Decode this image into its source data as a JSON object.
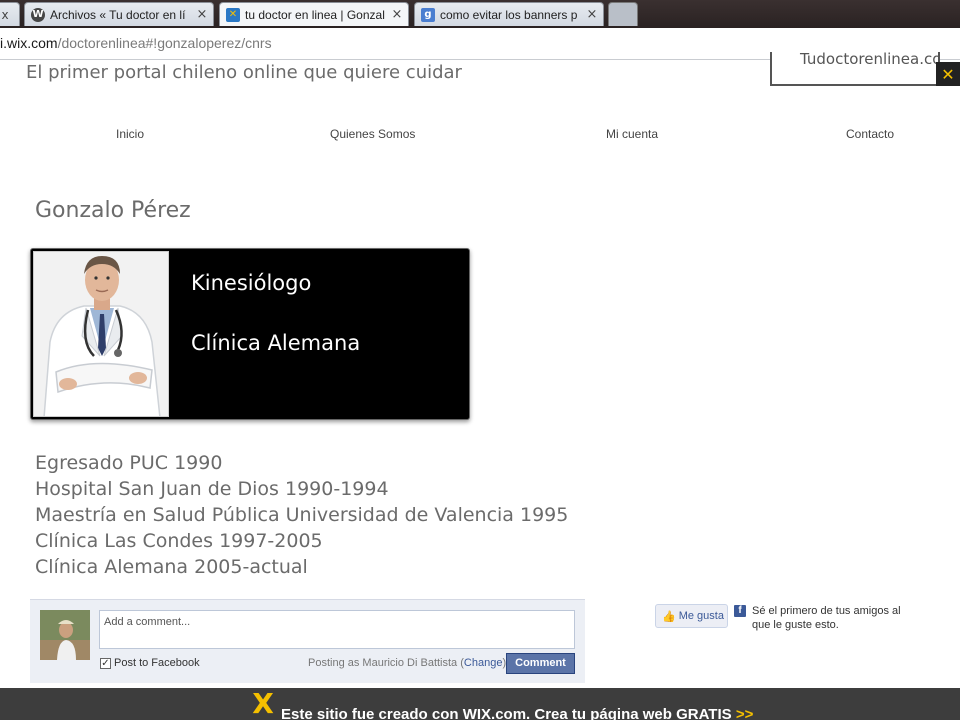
{
  "browser": {
    "tabs": [
      {
        "title": "Archivos « Tu doctor en lí",
        "icon": "wordpress-icon"
      },
      {
        "title": "tu doctor en linea | Gonzal",
        "icon": "wix-icon"
      },
      {
        "title": "como evitar los banners p",
        "icon": "google-icon"
      }
    ],
    "first_tab_close": "x",
    "close_glyph": "×",
    "url_host": "i.wix.com",
    "url_path": "/doctorenlinea#!gonzaloperez/cnrs"
  },
  "site": {
    "tagline": "El primer portal chileno online que quiere cuidar",
    "logo_text": "Tudoctorenlinea.com",
    "nav": [
      "Inicio",
      "Quienes Somos",
      "Mi cuenta",
      "Contacto"
    ]
  },
  "profile": {
    "name": "Gonzalo Pérez",
    "specialty": "Kinesiólogo",
    "clinic": "Clínica Alemana",
    "bio": [
      "Egresado PUC 1990",
      "Hospital San Juan de Dios 1990-1994",
      "Maestría en Salud Pública Universidad de Valencia 1995",
      "Clínica Las Condes 1997-2005",
      "Clínica Alemana 2005-actual"
    ]
  },
  "facebook": {
    "comment_placeholder": "Add a comment...",
    "post_to_facebook": "Post to Facebook",
    "posting_as": "Posting as Mauricio Di Battista",
    "change_label": "Change",
    "comment_button": "Comment",
    "like_button": "Me gusta",
    "like_text": "Sé el primero de tus amigos al que le guste esto."
  },
  "wix_banner": {
    "text": "Este sitio fue creado con WIX.com. Crea tu página web GRATIS",
    "arrows": ">>"
  },
  "colors": {
    "page_text": "#6b6b6b",
    "card_bg": "#000000",
    "fb_blue": "#3b5998",
    "wix_yellow": "#f5c000"
  }
}
